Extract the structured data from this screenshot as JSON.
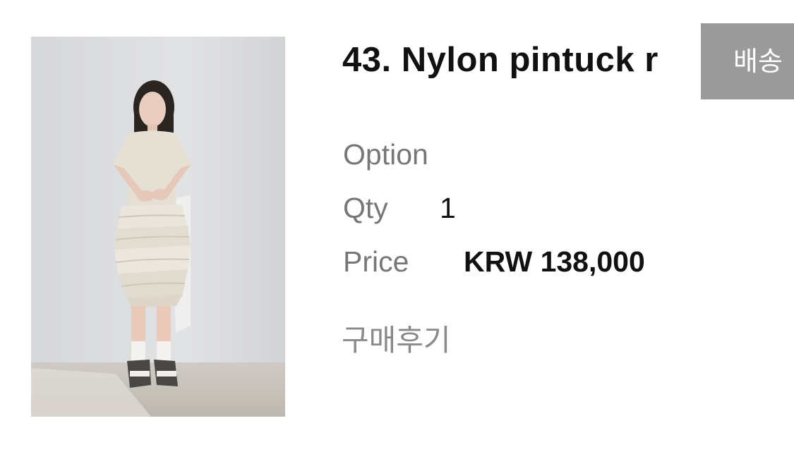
{
  "product": {
    "title": "43. Nylon pintuck r",
    "option_label": "Option",
    "qty_label": "Qty",
    "qty_value": "1",
    "price_label": "Price",
    "price_value": "KRW 138,000"
  },
  "links": {
    "review_label": "구매후기"
  },
  "shipping_button": {
    "label": "배송"
  },
  "colors": {
    "shipping_button_bg": "#9a9a9a",
    "label_text": "#777777",
    "value_text": "#111111"
  }
}
